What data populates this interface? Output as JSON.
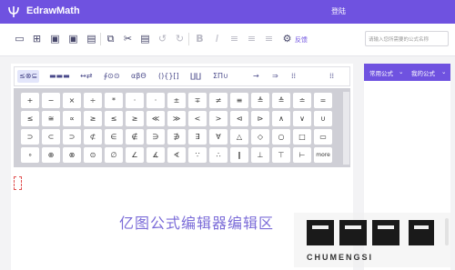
{
  "app": {
    "name": "EdrawMath",
    "login": "登陆"
  },
  "toolbar": {
    "feedback": "反馈",
    "search_placeholder": "请输入您所需要的公式名称"
  },
  "symbol_tabs": [
    "≤⊗⊆",
    "▬▬▬",
    "↔⇄",
    "∮⊙⊙",
    "αβΘ",
    "(){}[]",
    "∐∐",
    "ΣΠ∪",
    "→",
    "⇒",
    "⁞⁞"
  ],
  "symbols": [
    [
      "+",
      "−",
      "×",
      "÷",
      "*",
      "·",
      "·",
      "±",
      "∓",
      "≠",
      "≡",
      "≜",
      "≙",
      "≐",
      "="
    ],
    [
      "≤",
      "≅",
      "∝",
      "≥",
      "≤",
      "≥",
      "≪",
      "≫",
      "<",
      ">",
      "⊲",
      "⊳",
      "∧",
      "∨",
      "∪"
    ],
    [
      "⊃",
      "⊂",
      "⊃",
      "⊄",
      "∈",
      "∉",
      "∋",
      "∌",
      "∃",
      "∀",
      "△",
      "◇",
      "○",
      "□",
      "▭"
    ],
    [
      "∘",
      "⊕",
      "⊗",
      "⊙",
      "∅",
      "∠",
      "∡",
      "∢",
      "∵",
      "∴",
      "∥",
      "⊥",
      "⊤",
      "⊢",
      "more"
    ]
  ],
  "editor": {
    "watermark": "亿图公式编辑器编辑区"
  },
  "right_panel": {
    "tab1": "常用公式",
    "tab2": "我的公式"
  },
  "brand": {
    "name": "CHUMENGSI"
  },
  "colors": {
    "accent": "#6f52e0",
    "watermark": "#7b6cd8"
  }
}
